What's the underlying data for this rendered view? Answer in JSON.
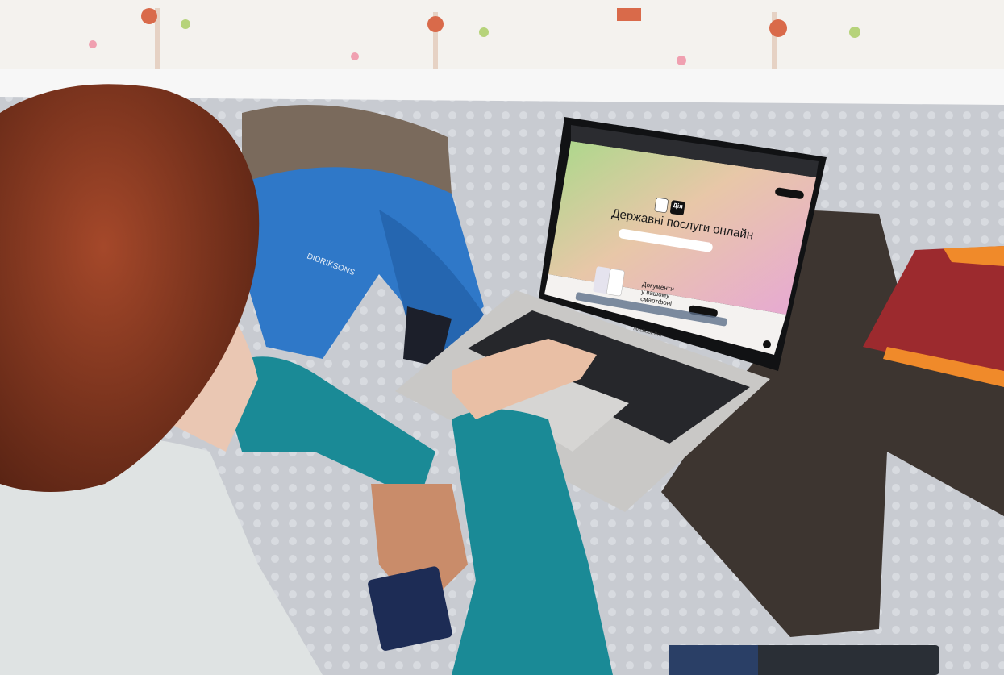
{
  "screen": {
    "logo_text": "Дія",
    "headline": "Державні послуги онлайн",
    "promo_text_lines": [
      "Документи",
      "у вашому",
      "смартфоні"
    ]
  },
  "laptop": {
    "model_label": "MacBook Pro"
  },
  "jacket": {
    "brand_text": "DIDRIKSONS"
  },
  "colors": {
    "wall": "#f4f2ee",
    "blanket": "#c9ccd0",
    "jacket": "#2f78c8",
    "sweater": "#1a8a96",
    "hair": "#8a3a1e",
    "pants": "#3d3530",
    "red_cloth": "#9c2a2e",
    "orange_trim": "#f08a2a"
  }
}
